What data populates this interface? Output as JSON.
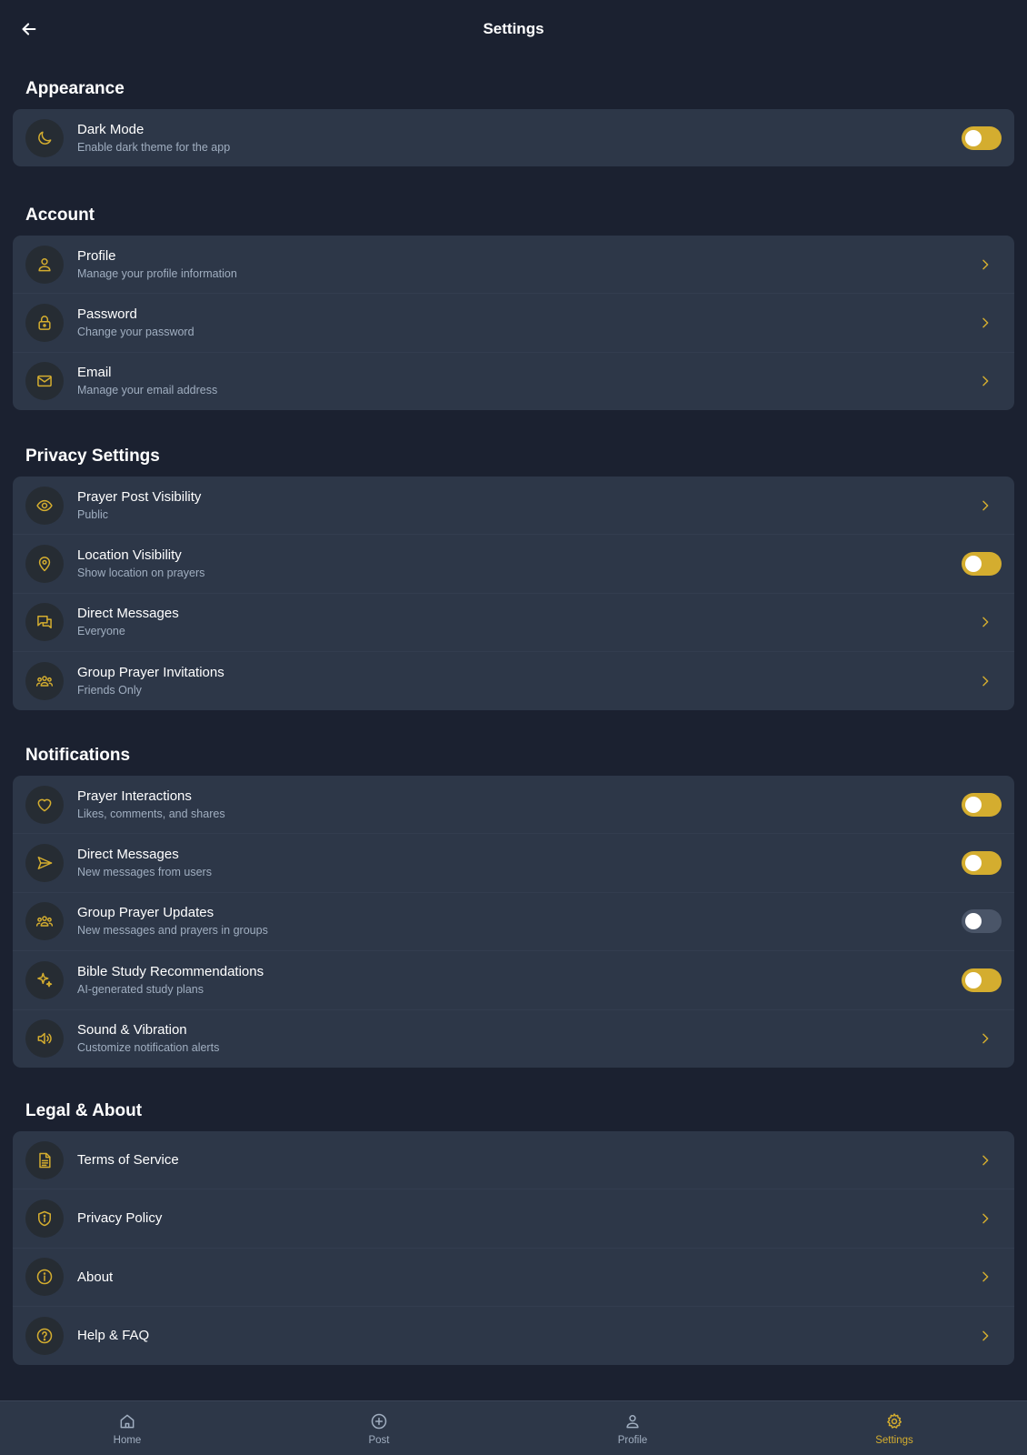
{
  "header": {
    "title": "Settings"
  },
  "colors": {
    "accent": "#d4ad2f",
    "background": "#1b2130",
    "card": "#2d3748",
    "toggle_off": "#4a5568"
  },
  "sections": [
    {
      "title": "Appearance",
      "rows": [
        {
          "icon": "moon-icon",
          "title": "Dark Mode",
          "subtitle": "Enable dark theme for the app",
          "control": "toggle",
          "on": true
        }
      ]
    },
    {
      "title": "Account",
      "rows": [
        {
          "icon": "user-icon",
          "title": "Profile",
          "subtitle": "Manage your profile information",
          "control": "chevron"
        },
        {
          "icon": "lock-icon",
          "title": "Password",
          "subtitle": "Change your password",
          "control": "chevron"
        },
        {
          "icon": "mail-icon",
          "title": "Email",
          "subtitle": "Manage your email address",
          "control": "chevron"
        }
      ]
    },
    {
      "title": "Privacy Settings",
      "rows": [
        {
          "icon": "eye-icon",
          "title": "Prayer Post Visibility",
          "subtitle": "Public",
          "control": "chevron"
        },
        {
          "icon": "location-pin-icon",
          "title": "Location Visibility",
          "subtitle": "Show location on prayers",
          "control": "toggle",
          "on": true
        },
        {
          "icon": "chat-bubbles-icon",
          "title": "Direct Messages",
          "subtitle": "Everyone",
          "control": "chevron"
        },
        {
          "icon": "group-icon",
          "title": "Group Prayer Invitations",
          "subtitle": "Friends Only",
          "control": "chevron"
        }
      ]
    },
    {
      "title": "Notifications",
      "rows": [
        {
          "icon": "heart-icon",
          "title": "Prayer Interactions",
          "subtitle": "Likes, comments, and shares",
          "control": "toggle",
          "on": true
        },
        {
          "icon": "send-icon",
          "title": "Direct Messages",
          "subtitle": "New messages from users",
          "control": "toggle",
          "on": true
        },
        {
          "icon": "group-icon",
          "title": "Group Prayer Updates",
          "subtitle": "New messages and prayers in groups",
          "control": "toggle",
          "on": false
        },
        {
          "icon": "sparkles-icon",
          "title": "Bible Study Recommendations",
          "subtitle": "AI-generated study plans",
          "control": "toggle",
          "on": true
        },
        {
          "icon": "speaker-icon",
          "title": "Sound & Vibration",
          "subtitle": "Customize notification alerts",
          "control": "chevron"
        }
      ]
    },
    {
      "title": "Legal & About",
      "rows": [
        {
          "icon": "document-icon",
          "title": "Terms of Service",
          "subtitle": "",
          "control": "chevron"
        },
        {
          "icon": "shield-icon",
          "title": "Privacy Policy",
          "subtitle": "",
          "control": "chevron"
        },
        {
          "icon": "info-icon",
          "title": "About",
          "subtitle": "",
          "control": "chevron"
        },
        {
          "icon": "help-icon",
          "title": "Help & FAQ",
          "subtitle": "",
          "control": "chevron"
        }
      ]
    }
  ],
  "bottom_nav": [
    {
      "icon": "home-icon",
      "label": "Home",
      "active": false
    },
    {
      "icon": "plus-circle-icon",
      "label": "Post",
      "active": false
    },
    {
      "icon": "user-icon",
      "label": "Profile",
      "active": false
    },
    {
      "icon": "gear-icon",
      "label": "Settings",
      "active": true
    }
  ]
}
